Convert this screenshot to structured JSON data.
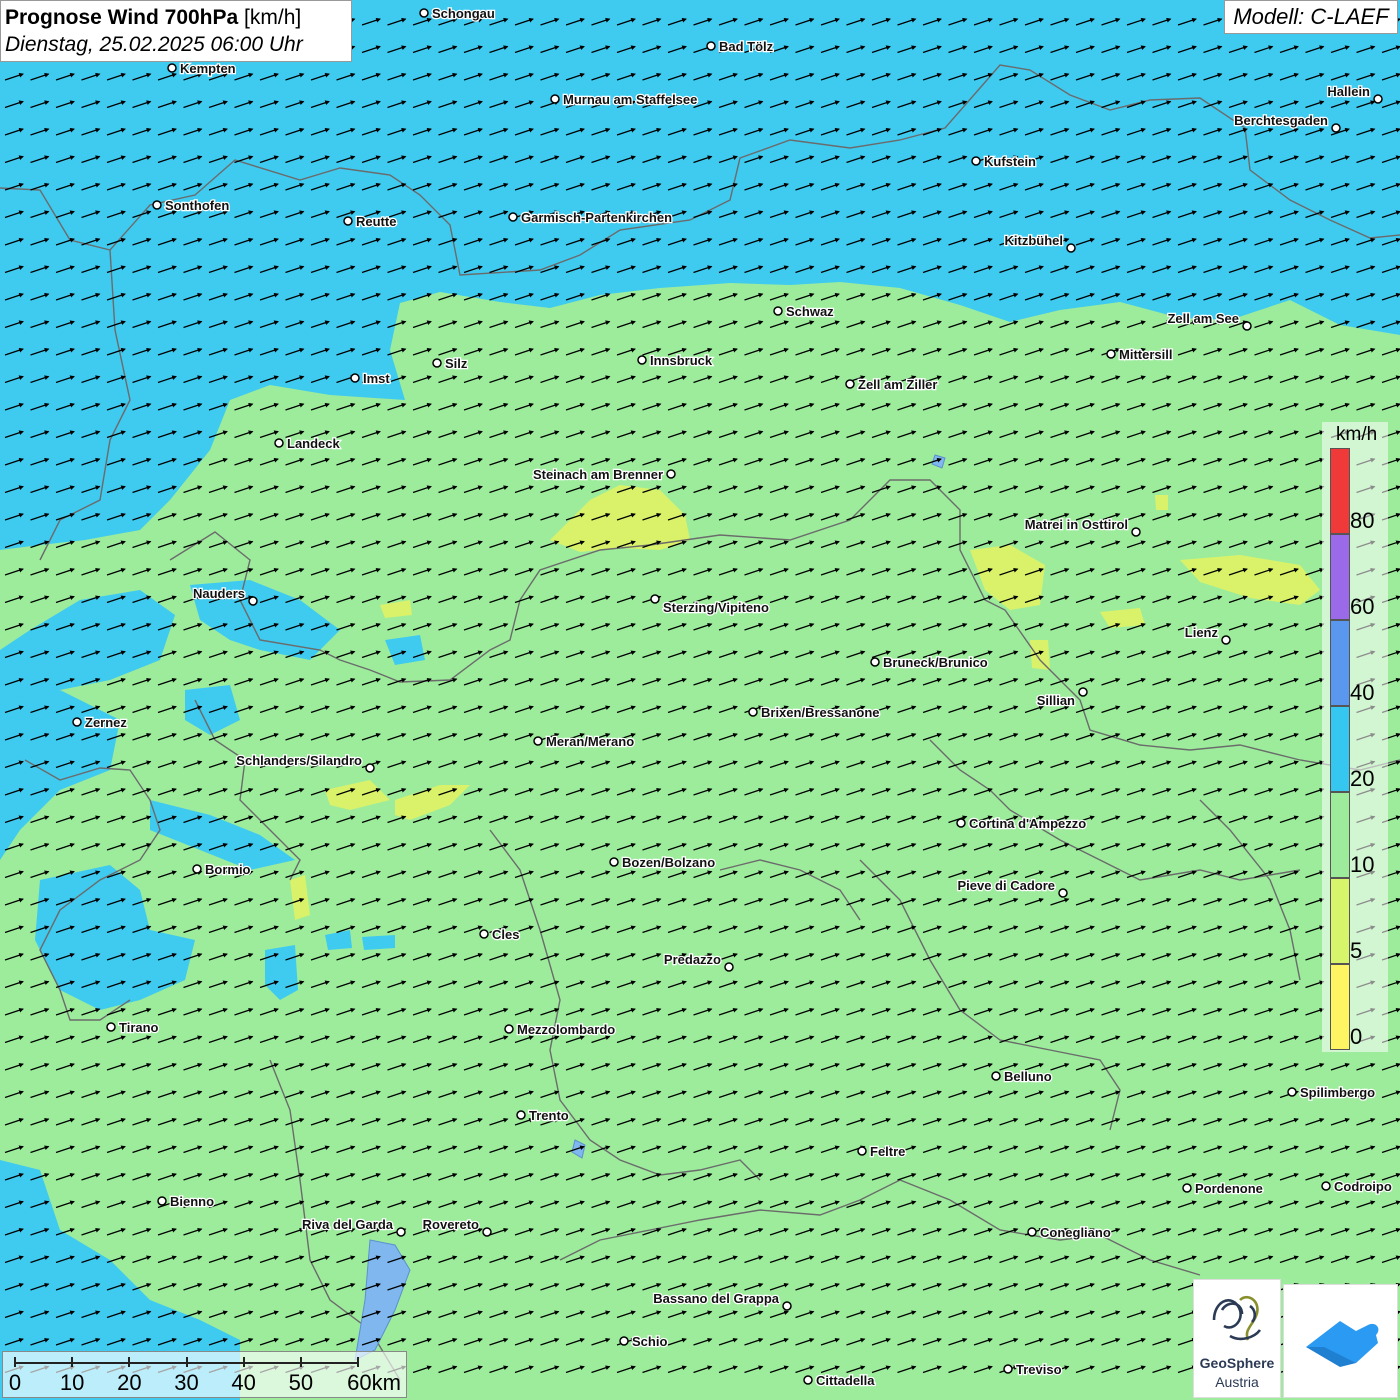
{
  "header": {
    "title_bold": "Prognose Wind 700hPa",
    "title_unit": "[km/h]",
    "datetime": "Dienstag, 25.02.2025 06:00 Uhr"
  },
  "model": {
    "label": "Modell: C-LAEF"
  },
  "legend": {
    "unit": "km/h",
    "bands": [
      {
        "from": 0,
        "to": 5,
        "color": "#fdf562"
      },
      {
        "from": 5,
        "to": 10,
        "color": "#d6f56a"
      },
      {
        "from": 10,
        "to": 20,
        "color": "#9cec9c"
      },
      {
        "from": 20,
        "to": 40,
        "color": "#35c7ef"
      },
      {
        "from": 40,
        "to": 60,
        "color": "#5a97ee"
      },
      {
        "from": 60,
        "to": 80,
        "color": "#9b6ae8"
      },
      {
        "from": 80,
        "to": 100,
        "color": "#f03a3a"
      }
    ],
    "tick_labels": [
      "0",
      "5",
      "10",
      "20",
      "40",
      "60",
      "80"
    ]
  },
  "scalebar": {
    "labels": [
      "0",
      "10",
      "20",
      "30",
      "40",
      "50",
      "60km"
    ]
  },
  "map": {
    "background_color": "#9cec9c",
    "wind_arrow_icon": "wind-arrow-icon",
    "wind_direction": "west-southwest wind, arrows pointing east-northeast"
  },
  "cities": [
    {
      "name": "Schongau"
    },
    {
      "name": "Bad Tölz"
    },
    {
      "name": "Kempten"
    },
    {
      "name": "Murnau am Staffelsee"
    },
    {
      "name": "Hallein"
    },
    {
      "name": "Berchtesgaden"
    },
    {
      "name": "Kufstein"
    },
    {
      "name": "Sonthofen"
    },
    {
      "name": "Reutte"
    },
    {
      "name": "Garmisch-Partenkirchen"
    },
    {
      "name": "Kitzbühel"
    },
    {
      "name": "Schwaz"
    },
    {
      "name": "Zell am See"
    },
    {
      "name": "Innsbruck"
    },
    {
      "name": "Mittersill"
    },
    {
      "name": "Imst"
    },
    {
      "name": "Silz"
    },
    {
      "name": "Zell am Ziller"
    },
    {
      "name": "Landeck"
    },
    {
      "name": "Steinach am Brenner"
    },
    {
      "name": "Matrei in Osttirol"
    },
    {
      "name": "Nauders"
    },
    {
      "name": "Sterzing/Vipiteno"
    },
    {
      "name": "Lienz"
    },
    {
      "name": "Bruneck/Brunico"
    },
    {
      "name": "Sillian"
    },
    {
      "name": "Brixen/Bressanone"
    },
    {
      "name": "Zernez"
    },
    {
      "name": "Meran/Merano"
    },
    {
      "name": "Schlanders/Silandro"
    },
    {
      "name": "Cortina d'Ampezzo"
    },
    {
      "name": "Bozen/Bolzano"
    },
    {
      "name": "Bormio"
    },
    {
      "name": "Pieve di Cadore"
    },
    {
      "name": "Cles"
    },
    {
      "name": "Predazzo"
    },
    {
      "name": "Tirano"
    },
    {
      "name": "Mezzolombardo"
    },
    {
      "name": "Belluno"
    },
    {
      "name": "Spilimbergo"
    },
    {
      "name": "Trento"
    },
    {
      "name": "Feltre"
    },
    {
      "name": "Pordenone"
    },
    {
      "name": "Codroipo"
    },
    {
      "name": "Bienno"
    },
    {
      "name": "Riva del Garda"
    },
    {
      "name": "Rovereto"
    },
    {
      "name": "Conegliano"
    },
    {
      "name": "Bassano del Grappa"
    },
    {
      "name": "Schio"
    },
    {
      "name": "Treviso"
    },
    {
      "name": "Cittadella"
    }
  ],
  "logos": {
    "geosphere_name": "GeoSphere",
    "geosphere_country": "Austria"
  }
}
